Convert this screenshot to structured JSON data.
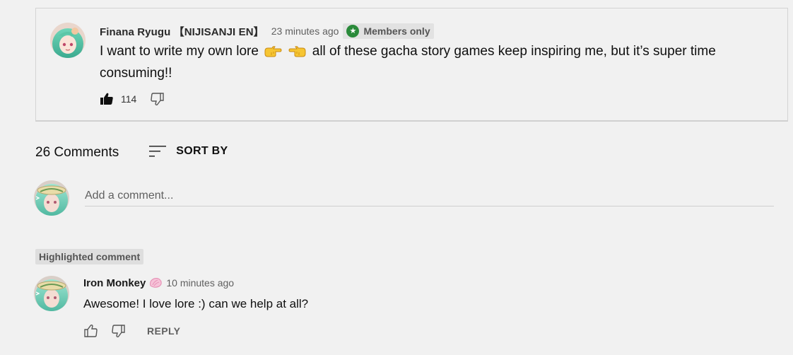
{
  "post": {
    "author": "Finana Ryugu 【NIJISANJI EN】",
    "time": "23 minutes ago",
    "badge_label": "Members only",
    "badge_icon": "star-icon",
    "text_before_emoji": "I want to write my own lore",
    "emojis": [
      "hand-point-right-emoji",
      "hand-point-left-emoji"
    ],
    "text_after_emoji": "all of these gacha story games keep inspiring me, but it’s super time consuming!!",
    "like_count": "114",
    "badge_color": "#2a8a3a"
  },
  "comments_section": {
    "count_label": "26 Comments",
    "sort_label": "SORT BY",
    "add_comment_placeholder": "Add a comment..."
  },
  "highlighted_comment": {
    "tag": "Highlighted comment",
    "author": "Iron Monkey",
    "member_badge_icon": "shell-member-icon",
    "time": "10 minutes ago",
    "text": "Awesome! I love lore :) can we help at all?",
    "reply_label": "REPLY"
  }
}
